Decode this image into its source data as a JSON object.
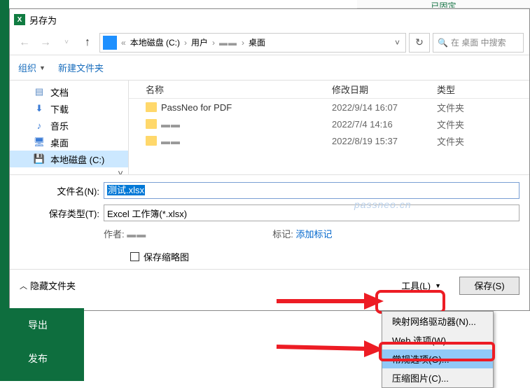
{
  "green_sidebar": {
    "export": "导出",
    "publish": "发布"
  },
  "top_fragment": "已固定",
  "title": "另存为",
  "breadcrumb": {
    "drive": "本地磁盘 (C:)",
    "users": "用户",
    "desktop": "桌面"
  },
  "search_placeholder": "在 桌面 中搜索",
  "toolbar": {
    "organize": "组织",
    "newfolder": "新建文件夹"
  },
  "sidebar": {
    "docs": "文档",
    "downloads": "下载",
    "music": "音乐",
    "desktop": "桌面",
    "drive": "本地磁盘 (C:)"
  },
  "columns": {
    "name": "名称",
    "date": "修改日期",
    "type": "类型"
  },
  "rows": [
    {
      "name": "PassNeo for PDF",
      "date": "2022/9/14 16:07",
      "type": "文件夹"
    },
    {
      "name": "▬▬",
      "date": "2022/7/4 14:16",
      "type": "文件夹"
    },
    {
      "name": "▬▬",
      "date": "2022/8/19 15:37",
      "type": "文件夹"
    }
  ],
  "filename": {
    "label": "文件名(N):",
    "value": "测试.xlsx"
  },
  "savetype": {
    "label": "保存类型(T):",
    "value": "Excel 工作簿(*.xlsx)"
  },
  "author_label": "作者:",
  "tag_label": "标记:",
  "tag_placeholder": "添加标记",
  "thumbnail": "保存缩略图",
  "hide_folders": "隐藏文件夹",
  "tools_btn": "工具(L)",
  "save_btn": "保存(S)",
  "menu": {
    "map_drive": "映射网络驱动器(N)...",
    "web_options": "Web 选项(W)...",
    "general_options": "常规选项(G)...",
    "compress_pics": "压缩图片(C)..."
  },
  "watermark": "passneo.cn"
}
